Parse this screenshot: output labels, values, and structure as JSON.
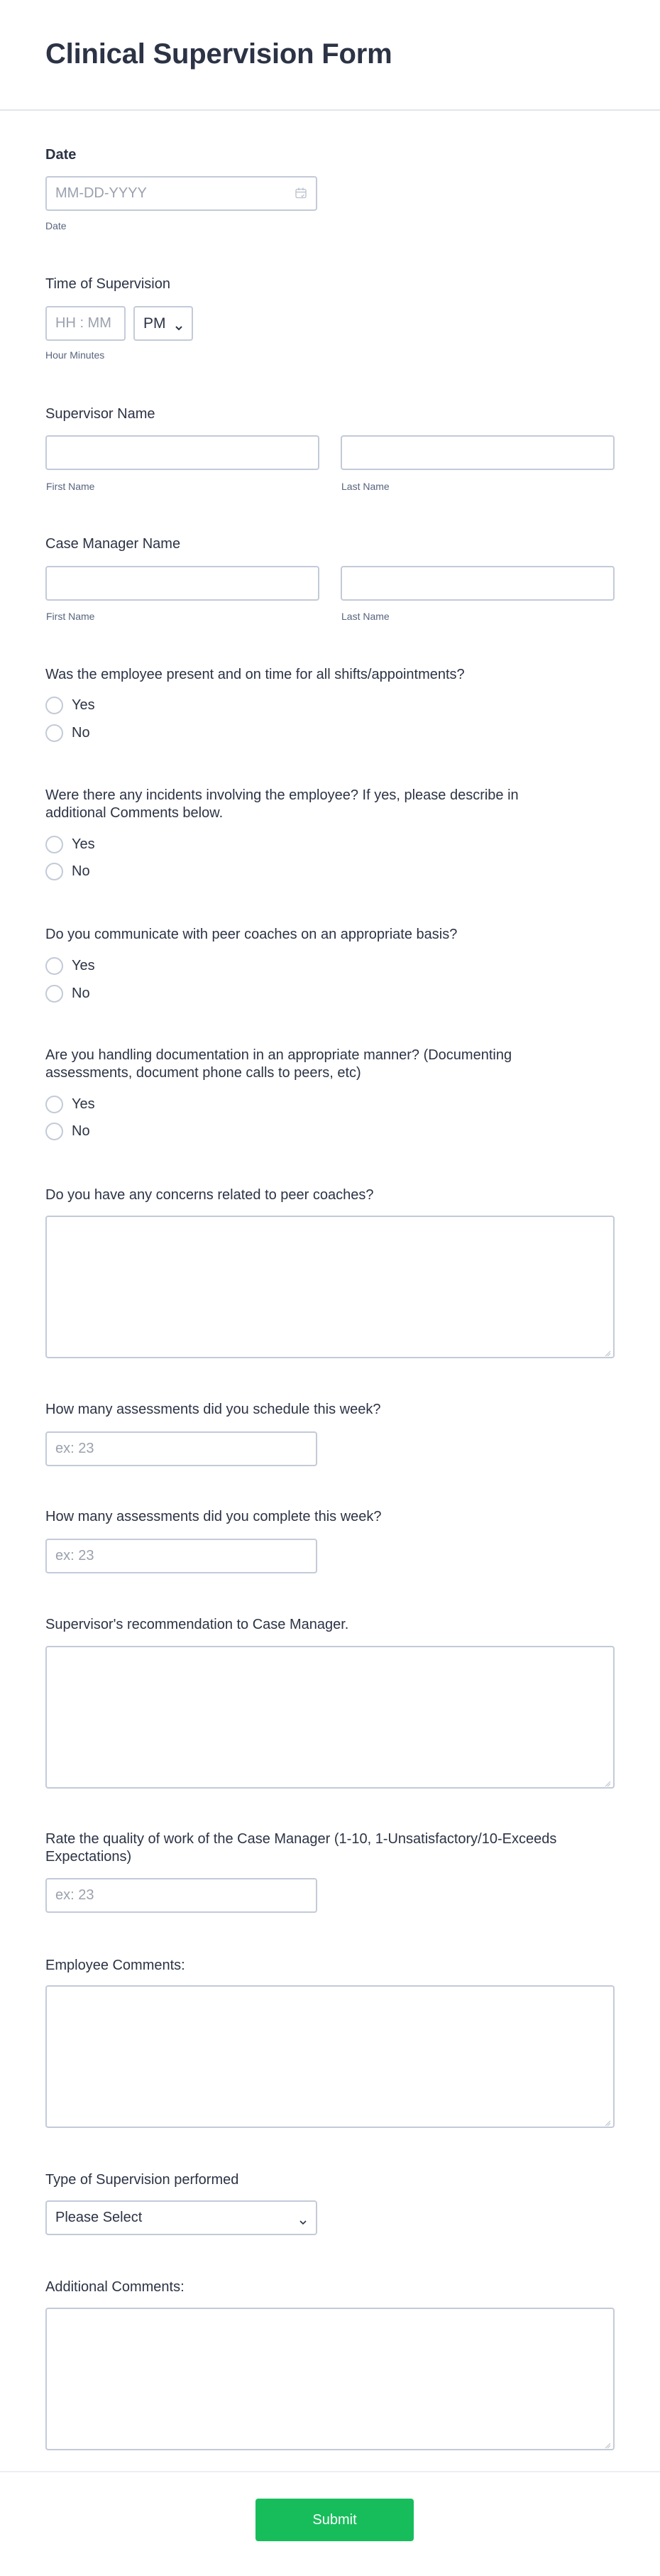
{
  "form": {
    "title": "Clinical Supervision Form"
  },
  "fields": {
    "date": {
      "label": "Date",
      "placeholder": "MM-DD-YYYY",
      "sublabel": "Date",
      "icon": "calendar-icon"
    },
    "time": {
      "label": "Time of Supervision",
      "placeholder": "HH : MM",
      "ampm_value": "PM",
      "sublabel": "Hour Minutes"
    },
    "supervisor_name": {
      "label": "Supervisor Name",
      "first_sublabel": "First Name",
      "last_sublabel": "Last Name",
      "first_value": "",
      "last_value": ""
    },
    "case_manager_name": {
      "label": "Case Manager Name",
      "first_sublabel": "First Name",
      "last_sublabel": "Last Name",
      "first_value": "",
      "last_value": ""
    },
    "q_present": {
      "label": "Was the employee present and on time for all shifts/appointments?",
      "options": [
        "Yes",
        "No"
      ]
    },
    "q_incidents": {
      "label": "Were there any incidents involving the employee? If yes, please describe in additional Comments below.",
      "options": [
        "Yes",
        "No"
      ]
    },
    "q_communicate": {
      "label": "Do you communicate with peer coaches on an appropriate basis?",
      "options": [
        "Yes",
        "No"
      ]
    },
    "q_documentation": {
      "label": "Are you handling documentation in an appropriate manner? (Documenting assessments, document phone calls to peers, etc)",
      "options": [
        "Yes",
        "No"
      ]
    },
    "concerns": {
      "label": "Do you have any concerns related to peer coaches?",
      "value": ""
    },
    "scheduled": {
      "label": "How many assessments did you schedule this week?",
      "placeholder": "ex: 23"
    },
    "completed": {
      "label": "How many assessments did you complete this week?",
      "placeholder": "ex: 23"
    },
    "recommendation": {
      "label": "Supervisor's recommendation to Case Manager.",
      "value": ""
    },
    "rating": {
      "label": "Rate the quality of work of the Case Manager (1-10, 1-Unsatisfactory/10-Exceeds Expectations)",
      "placeholder": "ex: 23"
    },
    "employee_comments": {
      "label": "Employee Comments:",
      "value": ""
    },
    "supervision_type": {
      "label": "Type of Supervision performed",
      "selected": "Please Select"
    },
    "additional_comments": {
      "label": "Additional Comments:",
      "value": ""
    }
  },
  "actions": {
    "submit_label": "Submit"
  },
  "colors": {
    "text": "#2c3345",
    "border": "#c3cad8",
    "placeholder": "#9aa1ae",
    "submit": "#18bd5b"
  }
}
